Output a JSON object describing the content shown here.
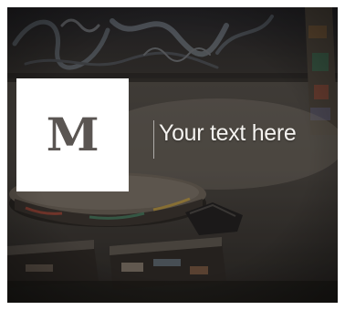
{
  "banner": {
    "logo_letter": "M",
    "caption": "Your text here"
  },
  "colors": {
    "logo_box": "#ffffff",
    "logo_letter": "#5a5552",
    "caption": "#f4f2ef",
    "frame": "#ffffff"
  },
  "icons": {
    "logo": "medium-logo-icon"
  }
}
